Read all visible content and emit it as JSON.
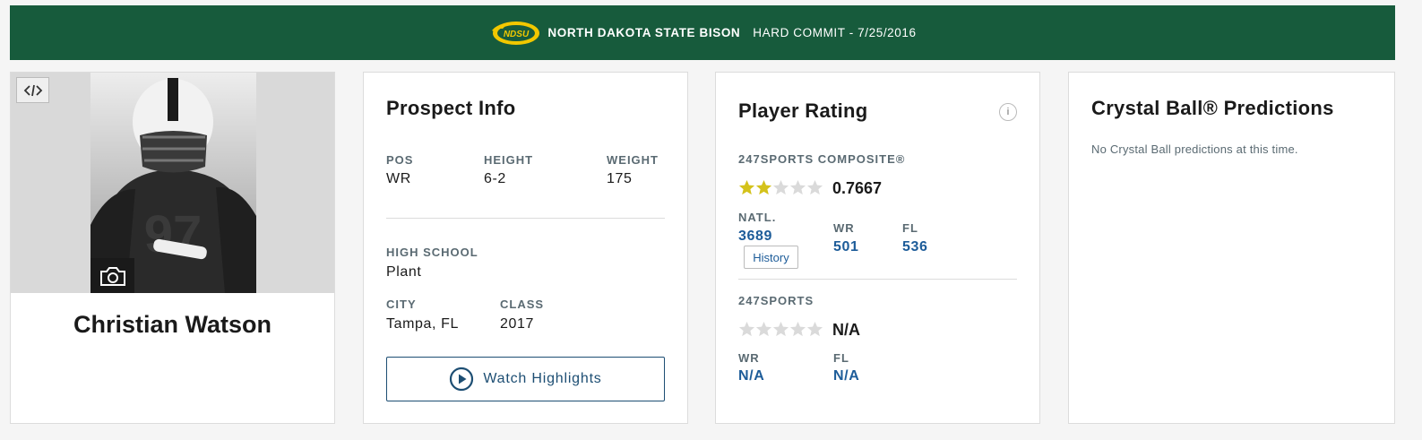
{
  "banner": {
    "logo_text": "NDSU",
    "school": "NORTH DAKOTA STATE BISON",
    "commit": "HARD COMMIT - 7/25/2016"
  },
  "player": {
    "name": "Christian Watson",
    "jersey": "97"
  },
  "prospect": {
    "title": "Prospect Info",
    "pos_label": "POS",
    "pos_value": "WR",
    "height_label": "HEIGHT",
    "height_value": "6-2",
    "weight_label": "WEIGHT",
    "weight_value": "175",
    "school_label": "HIGH SCHOOL",
    "school_value": "Plant",
    "city_label": "CITY",
    "city_value": "Tampa, FL",
    "class_label": "CLASS",
    "class_value": "2017",
    "watch_label": "Watch Highlights"
  },
  "rating": {
    "title": "Player Rating",
    "info_icon_text": "i",
    "composite_label": "247SPORTS COMPOSITE®",
    "composite_stars": 2,
    "composite_value": "0.7667",
    "natl_label": "NATL.",
    "natl_value": "3689",
    "history_label": "History",
    "pos_label": "WR",
    "pos_value": "501",
    "state_label": "FL",
    "state_value": "536",
    "sports_label": "247SPORTS",
    "sports_stars": 0,
    "sports_value": "N/A",
    "sports_pos_label": "WR",
    "sports_pos_value": "N/A",
    "sports_state_label": "FL",
    "sports_state_value": "N/A"
  },
  "crystal": {
    "title": "Crystal Ball® Predictions",
    "message": "No Crystal Ball predictions at this time."
  },
  "colors": {
    "banner_bg": "#175b3c",
    "star_filled": "#d4c21b",
    "star_empty": "#dadada",
    "link": "#1d5c99"
  }
}
